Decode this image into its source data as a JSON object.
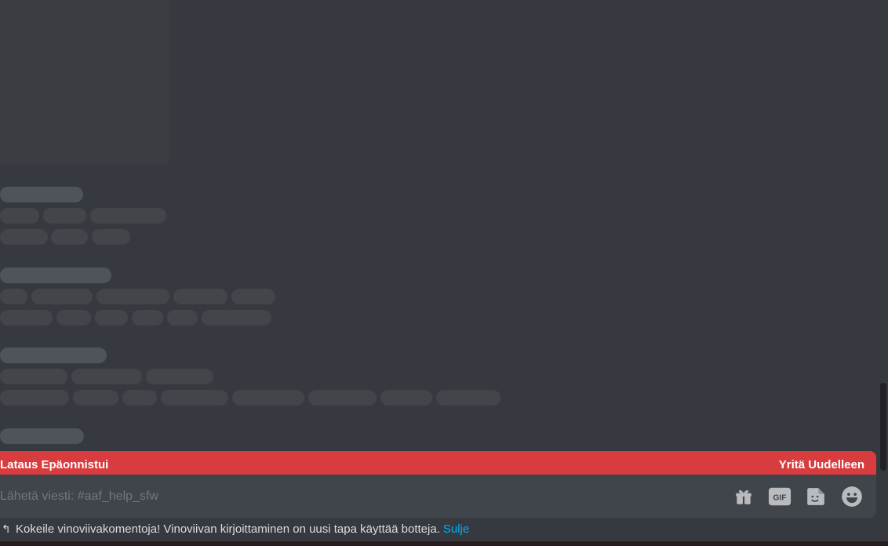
{
  "error_bar": {
    "message": "Lataus Epäonnistui",
    "retry_label": "Yritä Uudelleen"
  },
  "composer": {
    "placeholder": "Lähetä viesti: #aaf_help_sfw",
    "value": ""
  },
  "icons": [
    "gift-icon",
    "gif-icon",
    "sticker-icon",
    "emoji-icon"
  ],
  "gif_label": "GIF",
  "hint": {
    "arrow": "↰",
    "text": "Kokeile vinoviivakomentoja! Vinoviivan kirjoittaminen on uusi tapa käyttää botteja.",
    "close_label": "Sulje"
  },
  "colors": {
    "background": "#36393f",
    "error": "#d83c3e",
    "composer": "#40444b",
    "link": "#00aff4"
  }
}
